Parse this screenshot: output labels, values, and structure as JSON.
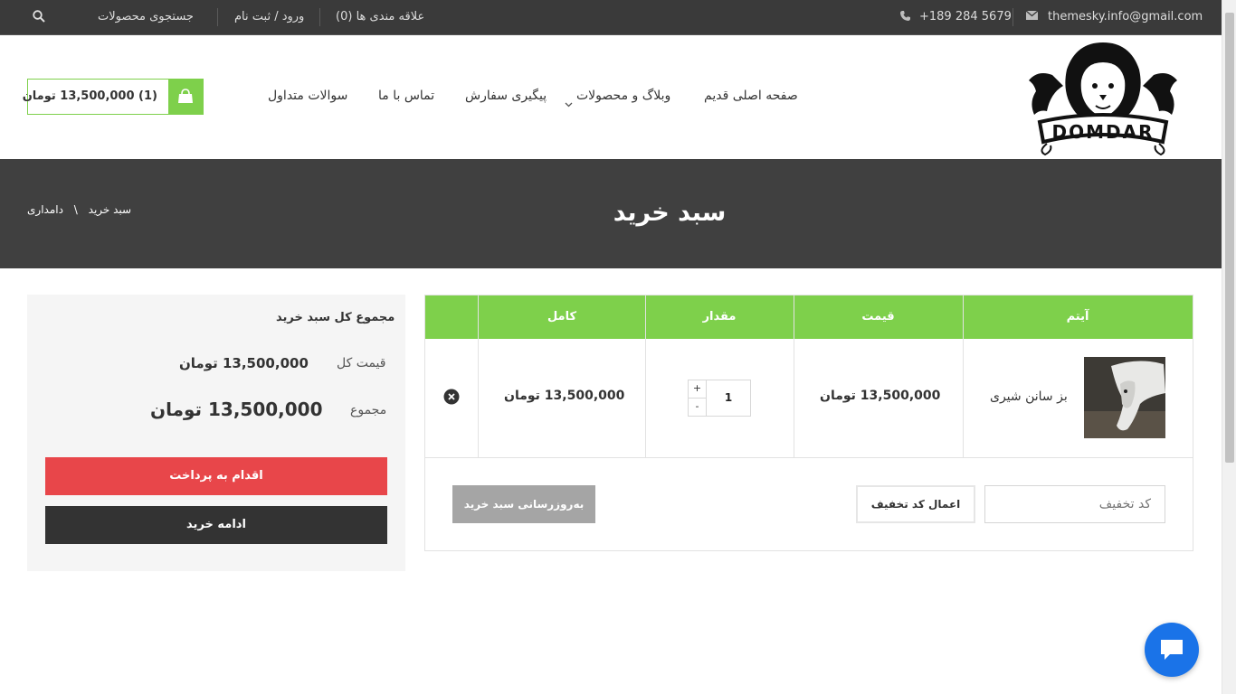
{
  "topbar": {
    "email": "themesky.info@gmail.com",
    "phone": "+189 284 5679",
    "wishlist": "علاقه مندی ها (0)",
    "login": "ورود / ثبت نام",
    "search": "جستجوی محصولات"
  },
  "brand": {
    "logo_text": "DOMDAR"
  },
  "nav": {
    "home": "صفحه اصلی قدیم",
    "blog": "وبلاگ و محصولات",
    "track": "پیگیری سفارش",
    "contact": "تماس با ما",
    "faq": "سوالات متداول"
  },
  "mini_cart": {
    "label": "(1)  13,500,000 تومان"
  },
  "hero": {
    "title": "سبد خرید",
    "crumb_home": "دامداری",
    "crumb_sep": "\\",
    "crumb_current": "سبد خرید"
  },
  "cart_table": {
    "headers": {
      "item": "آیتم",
      "price": "قیمت",
      "qty": "مقدار",
      "total": "کامل"
    },
    "row": {
      "product": "بز سانن شیری",
      "price": "13,500,000 تومان",
      "quantity": "1",
      "plus": "+",
      "minus": "-",
      "subtotal": "13,500,000 تومان"
    },
    "coupon_placeholder": "کد تخفیف",
    "apply_coupon": "اعمال کد تخفیف",
    "update_cart": "به‌روزرسانی سبد خرید"
  },
  "totals": {
    "title": "مجموع کل سبد خرید",
    "subtotal_label": "قیمت کل",
    "subtotal_value": "13,500,000 تومان",
    "total_label": "مجموع",
    "total_value": "13,500,000 تومان",
    "checkout": "اقدام به پرداخت",
    "continue": "ادامه خرید"
  },
  "colors": {
    "accent": "#7ed04b",
    "checkout": "#e8464a",
    "dark": "#404040",
    "chat": "#1a73e8"
  },
  "icons": [
    "envelope-icon",
    "phone-icon",
    "search-icon",
    "shopping-bag-icon",
    "chevron-down-icon",
    "remove-icon",
    "chat-icon"
  ]
}
